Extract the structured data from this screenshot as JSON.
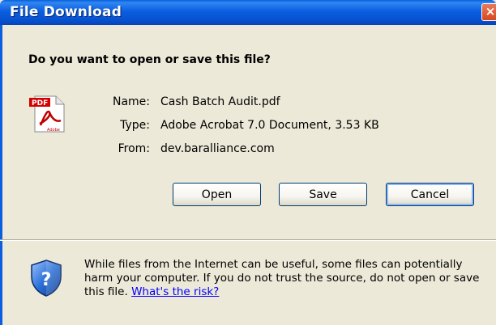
{
  "window": {
    "title": "File Download",
    "close_glyph": "×"
  },
  "dialog": {
    "question": "Do you want to open or save this file?",
    "file": {
      "name_label": "Name:",
      "name": "Cash Batch Audit.pdf",
      "type_label": "Type:",
      "type": "Adobe Acrobat 7.0 Document, 3.53 KB",
      "from_label": "From:",
      "from": "dev.baralliance.com"
    },
    "buttons": {
      "open": "Open",
      "save": "Save",
      "cancel": "Cancel"
    },
    "warning_text": "While files from the Internet can be useful, some files can potentially harm your computer. If you do not trust the source, do not open or save this file.",
    "risk_link": "What's the risk?",
    "icons": {
      "file": "pdf-file-icon",
      "security": "shield-question-icon"
    },
    "colors": {
      "titlebar": "#0b5ee0",
      "background": "#ece9d8",
      "link": "#0000ff"
    }
  }
}
